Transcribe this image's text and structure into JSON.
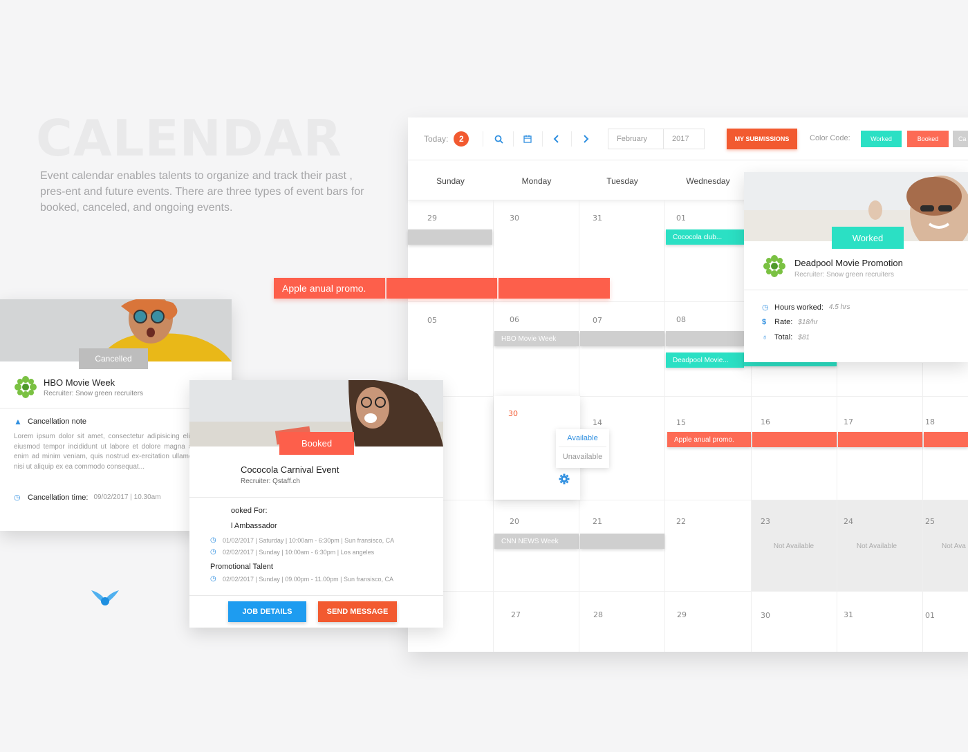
{
  "hero": {
    "title": "CALENDAR",
    "description": "Event calendar enables talents to organize and track their past , pres-ent and future events. There are three types of event bars for booked, canceled, and ongoing events."
  },
  "toolbar": {
    "today_label": "Today:",
    "today_count": "2",
    "month": "February",
    "year": "2017",
    "my_submissions": "MY SUBMISSIONS",
    "color_code_label": "Color Code:",
    "color_tags": [
      {
        "label": "Worked",
        "color": "#2be0c4"
      },
      {
        "label": "Booked",
        "color": "#fd6b55"
      },
      {
        "label": "Ca",
        "color": "#cfcfcf"
      }
    ]
  },
  "weekdays": [
    "Sunday",
    "Monday",
    "Tuesday",
    "Wednesday"
  ],
  "weeks": [
    [
      "29",
      "30",
      "31",
      "01"
    ],
    [
      "05",
      "06",
      "07",
      "08"
    ],
    [
      "",
      "30",
      "14",
      "15",
      "16",
      "17",
      "18"
    ],
    [
      "",
      "20",
      "21",
      "22",
      "23",
      "24",
      "25"
    ],
    [
      "",
      "27",
      "28",
      "29",
      "30",
      "31",
      "01"
    ]
  ],
  "not_available": [
    "Not Available",
    "Not Available",
    "Not Ava"
  ],
  "events": {
    "cococola_club": "Cococola club...",
    "hbo_week": "HBO Movie Week",
    "deadpool": "Deadpool Movie...",
    "apple_promo": "Apple anual promo.",
    "cnn_week": "CNN NEWS Week",
    "big_apple_promo": "Apple anual promo."
  },
  "availability": {
    "available": "Available",
    "unavailable": "Unavailable"
  },
  "worked_card": {
    "status": "Worked",
    "title": "Deadpool Movie Promotion",
    "recruiter": "Recruiter: Snow green recruiters",
    "hours_label": "Hours worked:",
    "hours_value": "4.5 hrs",
    "rate_label": "Rate:",
    "rate_value": "$18/hr",
    "total_label": "Total:",
    "total_value": "$81"
  },
  "cancelled_card": {
    "status": "Cancelled",
    "title": "HBO Movie Week",
    "recruiter": "Recruiter: Snow green recruiters",
    "note_label": "Cancellation note",
    "note_text": "Lorem ipsum dolor sit amet, consectetur adipisicing elit, sed do eiusmod tempor incididunt ut labore et dolore magna aliqua. Ut enim ad minim veniam, quis nostrud ex-ercitation ullamco laboris nisi ut aliquip ex ea commodo consequat...",
    "time_label": "Cancellation time:",
    "time_value": "09/02/2017  |  10.30am"
  },
  "booked_card": {
    "status": "Booked",
    "title": "Cococola Carnival Event",
    "recruiter": "Recruiter: Qstaff.ch",
    "booked_for": "ooked For:",
    "role1": "l Ambassador",
    "role1_lines": [
      "01/02/2017  |  Saturday  |  10:00am - 6:30pm  |  Sun fransisco, CA",
      "02/02/2017  |  Sunday  |  10:00am - 6:30pm  |  Los angeles"
    ],
    "role2": "Promotional Talent",
    "role2_lines": [
      "02/02/2017  |  Sunday  |  09.00pm - 11.00pm  |  Sun fransisco, CA"
    ],
    "job_details": "JOB DETAILS",
    "send_message": "SEND MESSAGE"
  }
}
